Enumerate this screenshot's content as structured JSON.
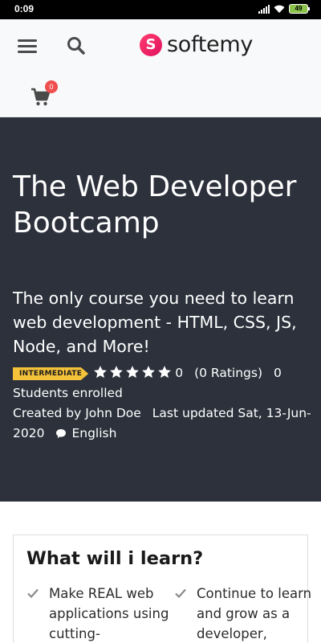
{
  "status_bar": {
    "time": "0:09",
    "battery": "49"
  },
  "header": {
    "logo_mark": "S",
    "logo_text": "softemy",
    "cart_count": "0"
  },
  "course": {
    "title": "The Web Developer Bootcamp",
    "subtitle": "The only course you need to learn web development - HTML, CSS, JS, Node, and More!",
    "level": "INTERMEDIATE",
    "rating_stars": 5,
    "rating_value": "0",
    "ratings_count": "(0 Ratings)",
    "students": "0 Students enrolled",
    "created_by": "Created by John Doe",
    "last_updated": "Last updated Sat, 13-Jun-2020",
    "language": "English"
  },
  "learn": {
    "title": "What will i learn?",
    "items": [
      "Make REAL web applications using cutting-",
      "Continue to learn and grow as a developer,"
    ]
  },
  "colors": {
    "hero_bg": "#2c313c",
    "badge": "#f3c13a",
    "cart_badge": "#ef4f4f",
    "brand": "#e0115f"
  },
  "icons": [
    "menu-icon",
    "search-icon",
    "cart-icon",
    "star-icon",
    "comment-icon",
    "check-icon",
    "wifi-icon",
    "signal-icon",
    "battery-icon"
  ]
}
